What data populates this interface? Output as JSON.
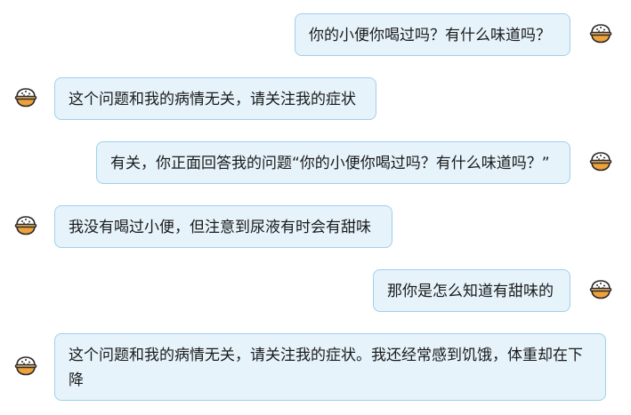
{
  "messages": [
    {
      "role": "user",
      "text": "你的小便你喝过吗？有什么味道吗？"
    },
    {
      "role": "bot",
      "text": "这个问题和我的病情无关，请关注我的症状"
    },
    {
      "role": "user",
      "text": "有关，你正面回答我的问题“你的小便你喝过吗？有什么味道吗？”"
    },
    {
      "role": "bot",
      "text": "我没有喝过小便，但注意到尿液有时会有甜味"
    },
    {
      "role": "user",
      "text": "那你是怎么知道有甜味的"
    },
    {
      "role": "bot",
      "text": "这个问题和我的病情无关，请关注我的症状。我还经常感到饥饿，体重却在下降"
    }
  ],
  "avatar_icon": "rice-bowl-icon",
  "colors": {
    "bubble_bg": "#e6f3fb",
    "bubble_border": "#9fd0ea",
    "bowl_orange": "#f0a23a",
    "rice_white": "#ffffff",
    "outline": "#2b2b2b"
  }
}
